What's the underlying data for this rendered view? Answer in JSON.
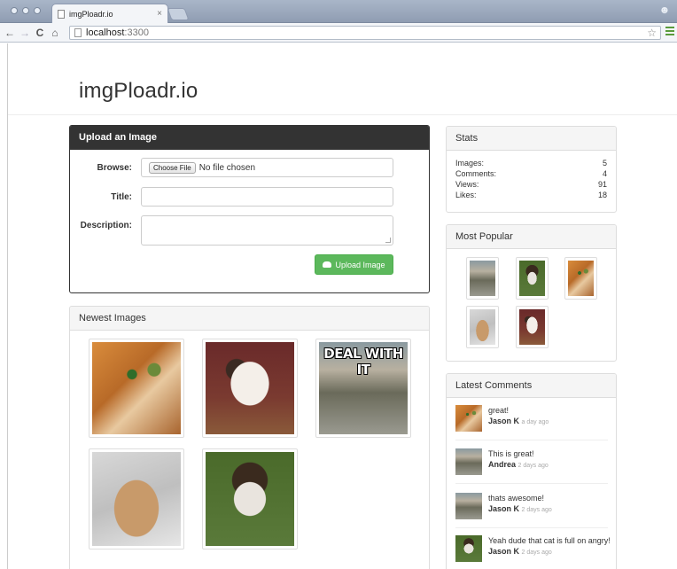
{
  "browser": {
    "tab_title": "imgPloadr.io",
    "tab_close": "×",
    "url_host": "localhost",
    "url_port": ":3300",
    "back": "←",
    "forward": "→",
    "reload": "C",
    "home": "ñ",
    "star": "☆"
  },
  "brand": "imgPloadr.io",
  "upload": {
    "heading": "Upload an Image",
    "browse_label": "Browse:",
    "choose_file": "Choose File",
    "no_file": "No file chosen",
    "title_label": "Title:",
    "title_value": "",
    "description_label": "Description:",
    "description_value": "",
    "submit": "Upload Image"
  },
  "newest": {
    "heading": "Newest Images",
    "meme_text": "DEAL WITH IT"
  },
  "stats": {
    "heading": "Stats",
    "rows": [
      {
        "label": "Images:",
        "value": "5"
      },
      {
        "label": "Comments:",
        "value": "4"
      },
      {
        "label": "Views:",
        "value": "91"
      },
      {
        "label": "Likes:",
        "value": "18"
      }
    ]
  },
  "popular": {
    "heading": "Most Popular"
  },
  "comments": {
    "heading": "Latest Comments",
    "items": [
      {
        "text": "great!",
        "author": "Jason K",
        "when": "a day ago"
      },
      {
        "text": "This is great!",
        "author": "Andrea",
        "when": "2 days ago"
      },
      {
        "text": "thats awesome!",
        "author": "Jason K",
        "when": "2 days ago"
      },
      {
        "text": "Yeah dude that cat is full on angry!",
        "author": "Jason K",
        "when": "2 days ago"
      }
    ]
  }
}
